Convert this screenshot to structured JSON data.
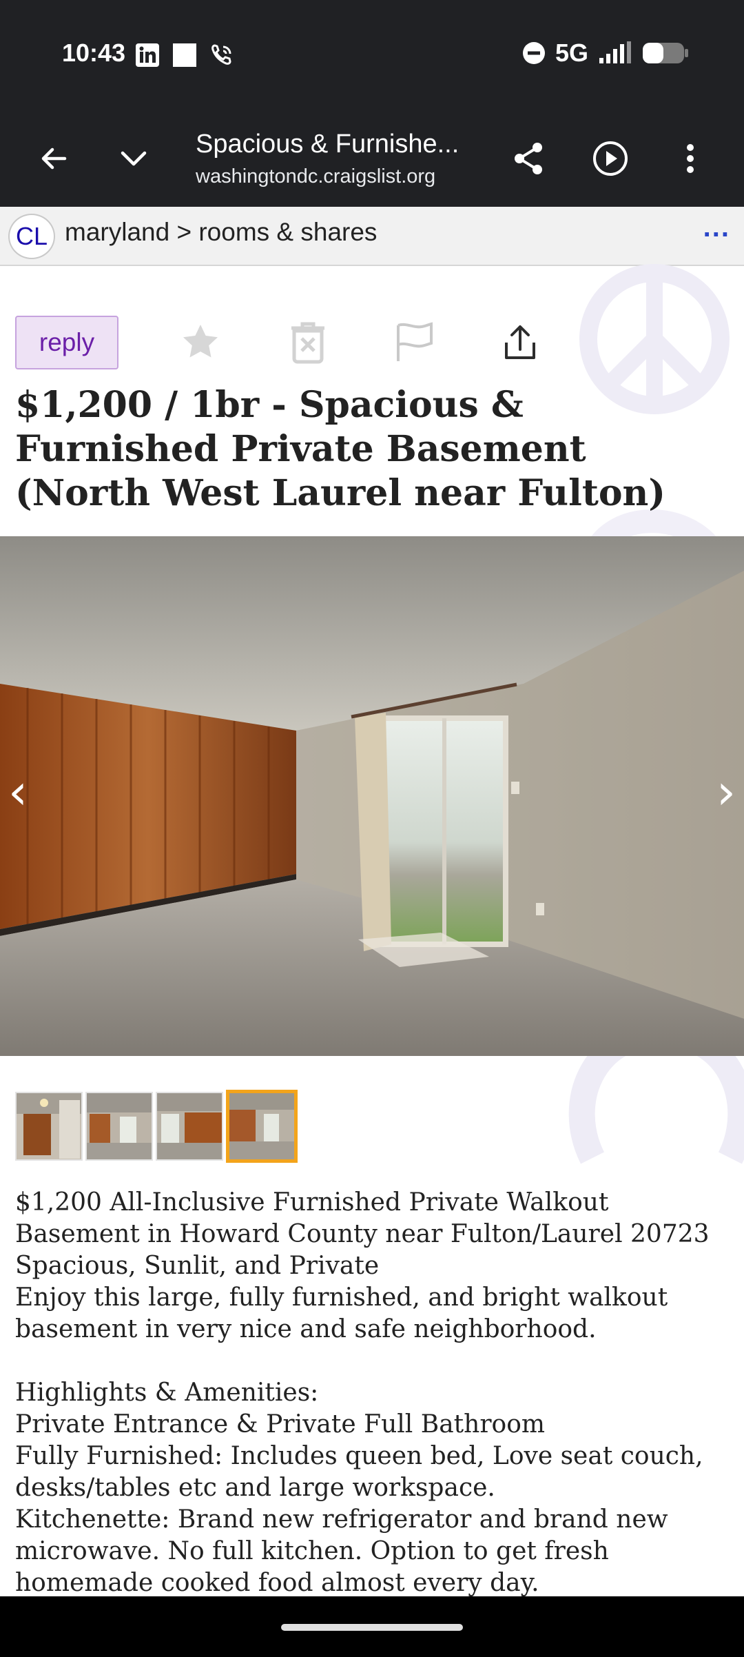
{
  "status_bar": {
    "time": "10:43",
    "network": "5G",
    "icons": [
      "linkedin-icon",
      "square-icon",
      "wifi-call-icon",
      "dnd-icon",
      "signal-icon",
      "battery-icon"
    ]
  },
  "browser": {
    "tab_title": "Spacious & Furnishe...",
    "url": "washingtondc.craigslist.org"
  },
  "breadcrumb": {
    "logo": "CL",
    "path": "maryland > rooms & shares",
    "more": "..."
  },
  "actions": {
    "reply_label": "reply"
  },
  "posting": {
    "title": "$1,200 / 1br - Spacious & Furnished Private Basement (North West Laurel near Fulton)",
    "body": "$1,200 All-Inclusive Furnished Private Walkout Basement in Howard County near Fulton/Laurel 20723\nSpacious, Sunlit, and Private\nEnjoy this large, fully furnished, and bright walkout basement in very nice and safe neighborhood.\n\nHighlights & Amenities:\nPrivate Entrance & Private Full Bathroom\nFully Furnished: Includes queen bed, Love seat couch, desks/tables etc and large workspace.\nKitchenette: Brand new refrigerator and brand new microwave. No full kitchen. Option to get fresh homemade cooked food almost every day."
  },
  "gallery": {
    "prev": "‹",
    "next": "›",
    "thumbnail_count": 4,
    "active_thumbnail": 4
  },
  "colors": {
    "reply_bg": "#eee2f5",
    "reply_text": "#6b1fa8",
    "active_thumb_border": "#f3a41b",
    "toolbar_bg": "#202124"
  }
}
